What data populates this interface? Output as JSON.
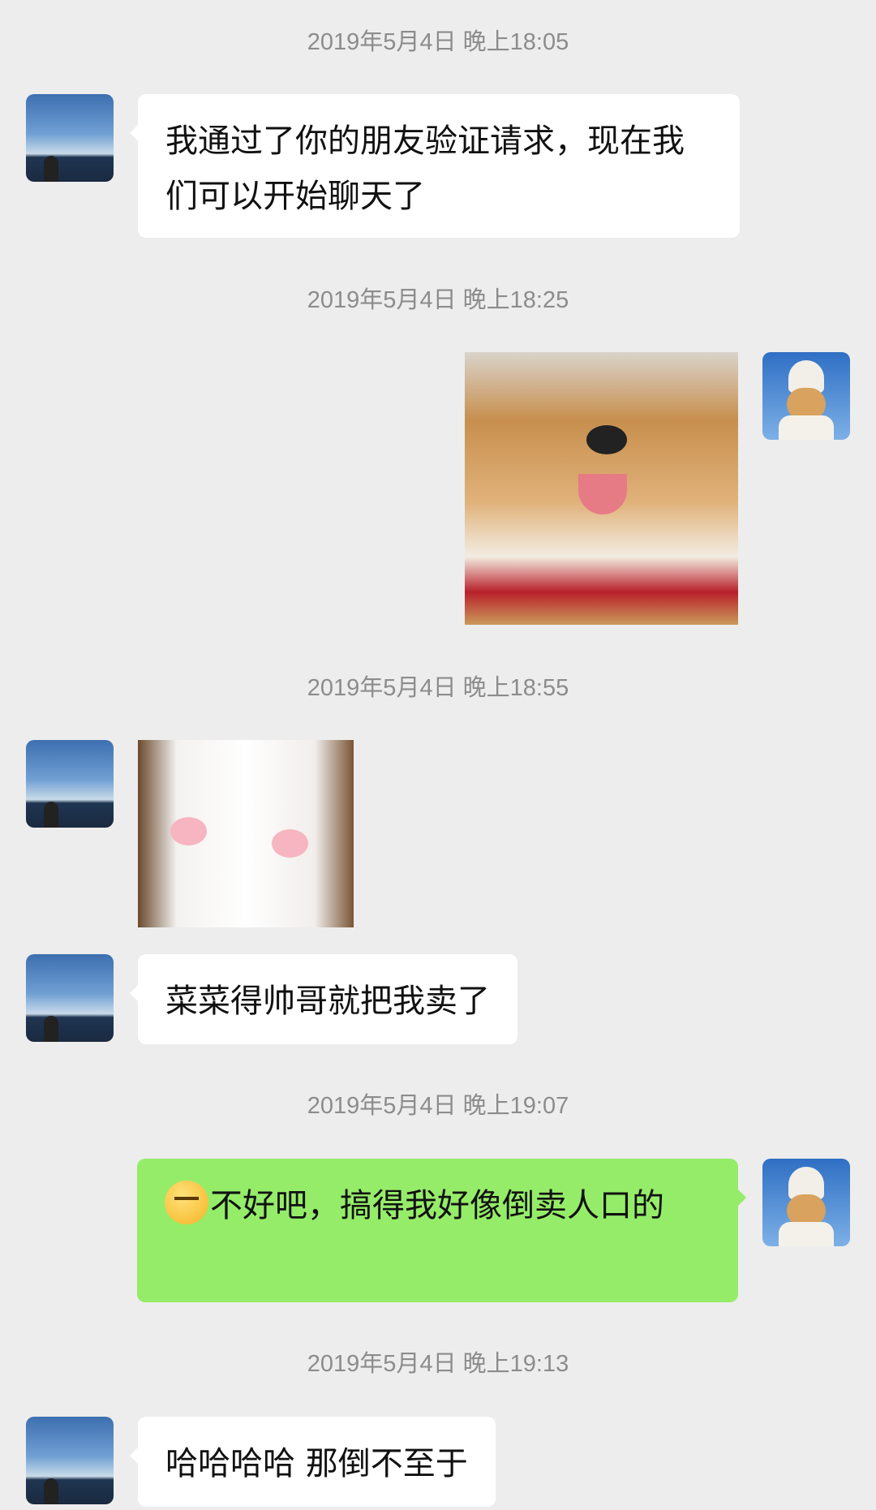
{
  "messages": [
    {
      "timestamp": "2019年5月4日 晚上18:05",
      "side": "left",
      "type": "text",
      "text": "我通过了你的朋友验证请求，现在我们可以开始聊天了"
    },
    {
      "timestamp": "2019年5月4日 晚上18:25",
      "side": "right",
      "type": "image",
      "icon": "shiba-dog-sticker"
    },
    {
      "timestamp": "2019年5月4日 晚上18:55",
      "side": "left",
      "type": "image",
      "icon": "white-cat-sticker"
    },
    {
      "side": "left",
      "type": "text",
      "text": "菜菜得帅哥就把我卖了"
    },
    {
      "timestamp": "2019年5月4日 晚上19:07",
      "side": "right",
      "type": "text",
      "emoji": "smirk-emoji",
      "text": "不好吧，搞得我好像倒卖人口的"
    },
    {
      "timestamp": "2019年5月4日 晚上19:13",
      "side": "left",
      "type": "text",
      "text": "哈哈哈哈 那倒不至于"
    }
  ],
  "colors": {
    "background": "#ededed",
    "sent_bubble": "#95ec69",
    "received_bubble": "#ffffff",
    "timestamp": "#8c8c8c"
  }
}
